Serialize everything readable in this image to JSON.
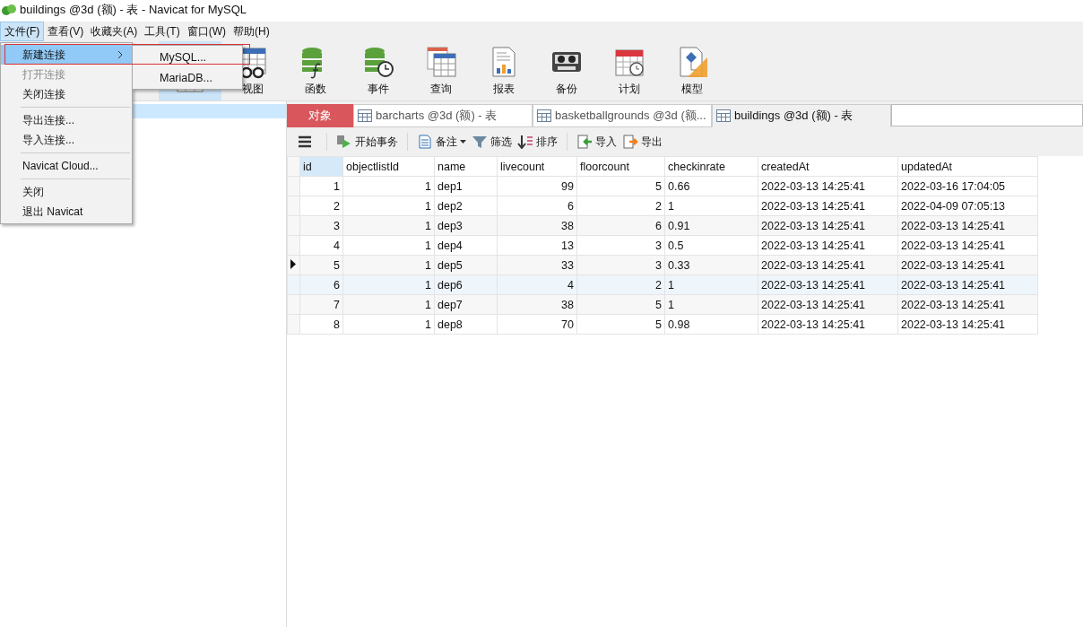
{
  "window": {
    "title": "buildings @3d (额) - 表 - Navicat for MySQL"
  },
  "menubar": [
    {
      "label": "文件(F)",
      "selected": true
    },
    {
      "label": "查看(V)",
      "selected": false
    },
    {
      "label": "收藏夹(A)",
      "selected": false
    },
    {
      "label": "工具(T)",
      "selected": false
    },
    {
      "label": "窗口(W)",
      "selected": false
    },
    {
      "label": "帮助(H)",
      "selected": false
    }
  ],
  "file_menu": {
    "items": [
      {
        "kind": "item",
        "label": "新建连接",
        "disabled": false,
        "selected": true,
        "submenu": true
      },
      {
        "kind": "item",
        "label": "打开连接",
        "disabled": true,
        "selected": false,
        "submenu": false
      },
      {
        "kind": "item",
        "label": "关闭连接",
        "disabled": false,
        "selected": false,
        "submenu": false
      },
      {
        "kind": "separator"
      },
      {
        "kind": "item",
        "label": "导出连接...",
        "disabled": false,
        "selected": false,
        "submenu": false
      },
      {
        "kind": "item",
        "label": "导入连接...",
        "disabled": false,
        "selected": false,
        "submenu": false
      },
      {
        "kind": "separator"
      },
      {
        "kind": "item",
        "label": "Navicat Cloud...",
        "disabled": false,
        "selected": false,
        "submenu": false
      },
      {
        "kind": "separator"
      },
      {
        "kind": "item",
        "label": "关闭",
        "disabled": false,
        "selected": false,
        "submenu": false
      },
      {
        "kind": "item",
        "label": "退出 Navicat",
        "disabled": false,
        "selected": false,
        "submenu": false
      }
    ],
    "submenu": [
      {
        "label": "MySQL..."
      },
      {
        "label": "MariaDB..."
      }
    ]
  },
  "toolbar": [
    {
      "selected": true
    },
    {
      "label": "视图",
      "selected": false
    },
    {
      "label": "函数",
      "selected": false
    },
    {
      "label": "事件",
      "selected": false
    },
    {
      "label": "查询",
      "selected": false
    },
    {
      "label": "报表",
      "selected": false
    },
    {
      "label": "备份",
      "selected": false
    },
    {
      "label": "计划",
      "selected": false
    },
    {
      "label": "模型",
      "selected": false
    }
  ],
  "tabs": [
    {
      "kind": "objects",
      "label": "对象",
      "selected": false
    },
    {
      "kind": "table",
      "label": "barcharts @3d (额) - 表",
      "selected": false
    },
    {
      "kind": "table",
      "label": "basketballgrounds @3d (额...",
      "selected": false
    },
    {
      "kind": "table",
      "label": "buildings @3d (额) - 表",
      "selected": true
    }
  ],
  "table_toolbar": [
    {
      "label": "开始事务"
    },
    {
      "label": "备注"
    },
    {
      "label": "筛选"
    },
    {
      "label": "排序"
    },
    {
      "label": "导入"
    },
    {
      "label": "导出"
    }
  ],
  "table": {
    "columns": [
      {
        "name": "id",
        "kind": "number",
        "selected": true
      },
      {
        "name": "objectlistId",
        "kind": "number",
        "selected": false
      },
      {
        "name": "name",
        "kind": "text",
        "selected": false
      },
      {
        "name": "livecount",
        "kind": "number",
        "selected": false
      },
      {
        "name": "floorcount",
        "kind": "number",
        "selected": false
      },
      {
        "name": "checkinrate",
        "kind": "text",
        "selected": false
      },
      {
        "name": "createdAt",
        "kind": "text",
        "selected": false
      },
      {
        "name": "updatedAt",
        "kind": "text",
        "selected": false
      }
    ],
    "rows": [
      {
        "current": false,
        "highlighted": false,
        "cells": [
          "1",
          "1",
          "dep1",
          "99",
          "5",
          "0.66",
          "2022-03-13 14:25:41",
          "2022-03-16 17:04:05"
        ]
      },
      {
        "current": false,
        "highlighted": false,
        "cells": [
          "2",
          "1",
          "dep2",
          "6",
          "2",
          "1",
          "2022-03-13 14:25:41",
          "2022-04-09 07:05:13"
        ]
      },
      {
        "current": false,
        "highlighted": false,
        "cells": [
          "3",
          "1",
          "dep3",
          "38",
          "6",
          "0.91",
          "2022-03-13 14:25:41",
          "2022-03-13 14:25:41"
        ]
      },
      {
        "current": false,
        "highlighted": false,
        "cells": [
          "4",
          "1",
          "dep4",
          "13",
          "3",
          "0.5",
          "2022-03-13 14:25:41",
          "2022-03-13 14:25:41"
        ]
      },
      {
        "current": true,
        "highlighted": false,
        "cells": [
          "5",
          "1",
          "dep5",
          "33",
          "3",
          "0.33",
          "2022-03-13 14:25:41",
          "2022-03-13 14:25:41"
        ]
      },
      {
        "current": false,
        "highlighted": true,
        "cells": [
          "6",
          "1",
          "dep6",
          "4",
          "2",
          "1",
          "2022-03-13 14:25:41",
          "2022-03-13 14:25:41"
        ]
      },
      {
        "current": false,
        "highlighted": false,
        "cells": [
          "7",
          "1",
          "dep7",
          "38",
          "5",
          "1",
          "2022-03-13 14:25:41",
          "2022-03-13 14:25:41"
        ]
      },
      {
        "current": false,
        "highlighted": false,
        "cells": [
          "8",
          "1",
          "dep8",
          "70",
          "5",
          "0.98",
          "2022-03-13 14:25:41",
          "2022-03-13 14:25:41"
        ]
      }
    ]
  }
}
